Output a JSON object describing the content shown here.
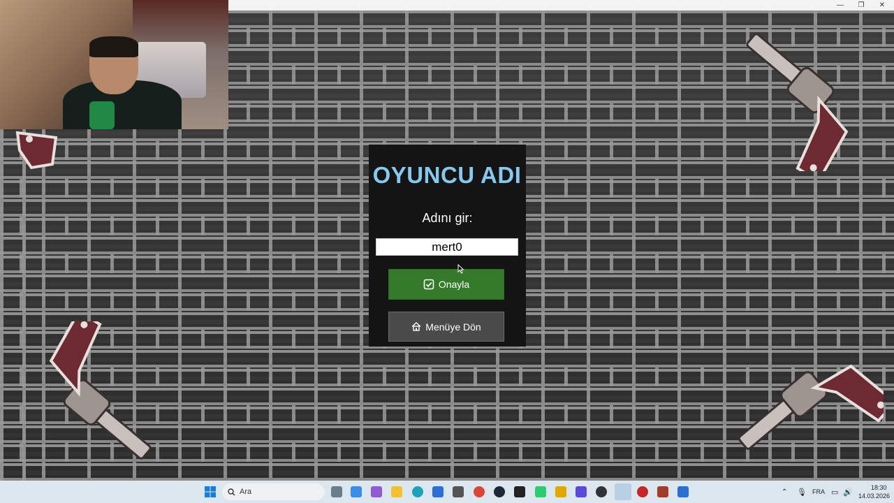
{
  "window": {
    "controls": [
      "—",
      "❐",
      "✕"
    ]
  },
  "dialog": {
    "title": "OYUNCU ADI",
    "prompt": "Adını gir:",
    "name_value": "mert0",
    "confirm_label": "Onayla",
    "menu_label": "Menüye Dön"
  },
  "taskbar": {
    "search_placeholder": "Ara",
    "language": "FRA",
    "time": "18:30",
    "date": "14.03.2026"
  },
  "colors": {
    "title": "#87c8ef",
    "confirm_button": "#357a2a",
    "menu_button": "#4a4a4a",
    "dialog_bg": "#141414"
  },
  "icons": [
    "checkbox-icon",
    "house-icon",
    "search-icon",
    "windows-start-icon"
  ]
}
